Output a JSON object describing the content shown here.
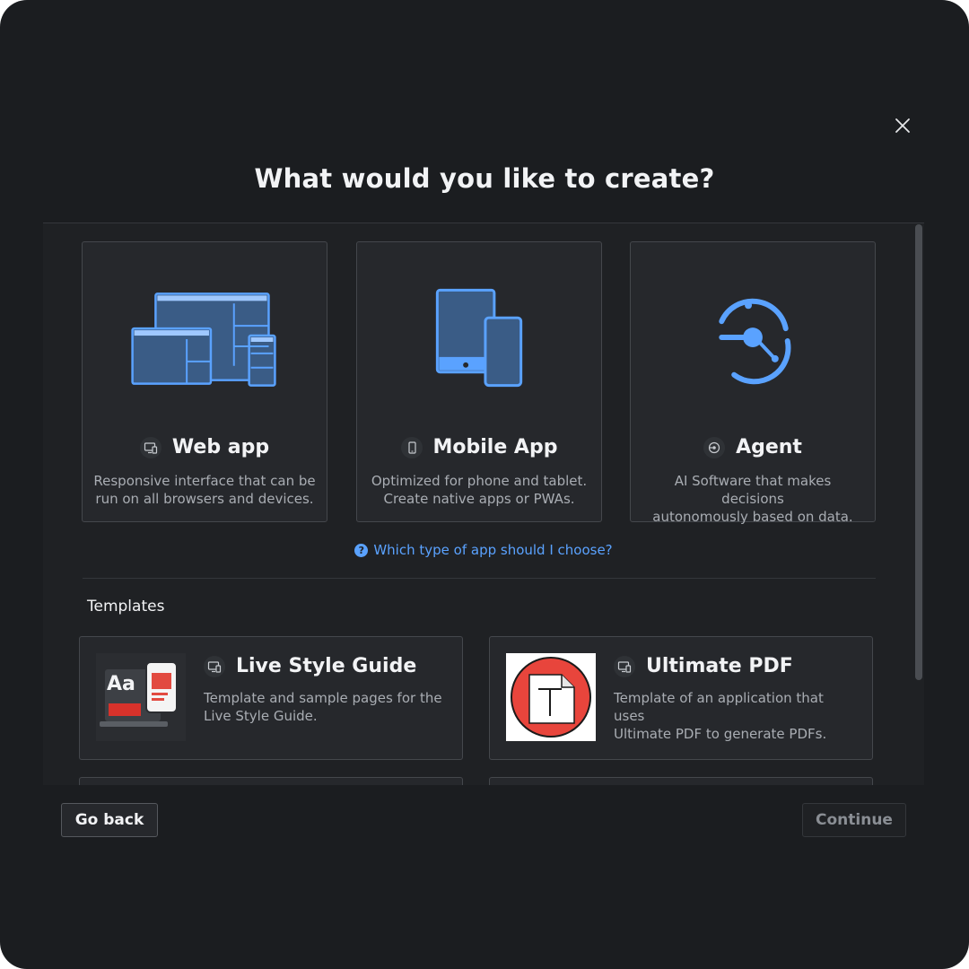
{
  "dialog": {
    "title": "What would you like to create?",
    "close_icon": "close-icon"
  },
  "app_types": [
    {
      "name": "Web app",
      "description_line1": "Responsive interface that can be",
      "description_line2": "run on all browsers and devices.",
      "illustration": "web-app-illustration",
      "icon": "desktop-mobile-icon"
    },
    {
      "name": "Mobile App",
      "description_line1": "Optimized for phone and tablet.",
      "description_line2": "Create native apps or PWAs.",
      "illustration": "mobile-app-illustration",
      "icon": "phone-icon"
    },
    {
      "name": "Agent",
      "description_line1": "AI Software that makes decisions",
      "description_line2": "autonomously based on data.",
      "illustration": "agent-illustration",
      "icon": "agent-icon"
    }
  ],
  "help_link": {
    "label": "Which type of app should I choose?",
    "icon": "question-circle-icon"
  },
  "templates": {
    "section_label": "Templates",
    "items": [
      {
        "name": "Live Style Guide",
        "description_line1": "Template and sample pages for the",
        "description_line2": "Live Style Guide.",
        "thumb_text": "Aa",
        "icon": "desktop-mobile-icon"
      },
      {
        "name": "Ultimate PDF",
        "description_line1": "Template of an application that uses",
        "description_line2": "Ultimate PDF to generate PDFs.",
        "icon": "desktop-mobile-icon"
      }
    ]
  },
  "footer": {
    "back_label": "Go back",
    "continue_label": "Continue"
  },
  "colors": {
    "background": "#1b1d20",
    "card": "#26282c",
    "accent": "#5aa2ff",
    "illustration_blue": "#4f95f0",
    "pdf_red": "#e8453c"
  }
}
